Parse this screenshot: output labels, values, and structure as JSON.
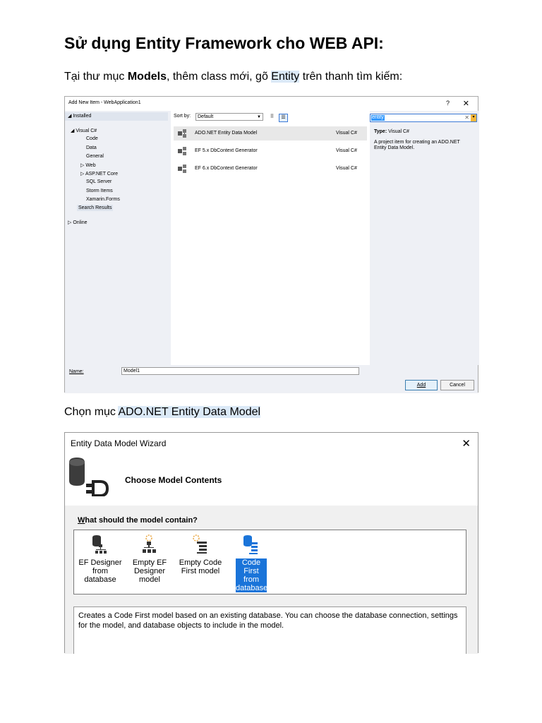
{
  "doc": {
    "title": "Sử dụng Entity Framework cho WEB API:",
    "para1": {
      "t1": "Tại thư mục ",
      "b1": "Models",
      "t2": ", thêm class mới, gõ ",
      "h1": "Entity",
      "t3": " trên thanh tìm kiếm:"
    },
    "para2": {
      "t1": "Chọn mục ",
      "h1": "ADO.NET Entity Data Model"
    }
  },
  "add_item_dialog": {
    "title": "Add New Item - WebApplication1",
    "help": "?",
    "close": "✕",
    "installed_label": "◢ Installed",
    "tree": [
      {
        "label": "◢  Visual C#"
      },
      {
        "label": "Code"
      },
      {
        "label": "Data"
      },
      {
        "label": "General"
      },
      {
        "label": "▷  Web"
      },
      {
        "label": "▷  ASP.NET Core"
      },
      {
        "label": "SQL Server"
      },
      {
        "label": "Storm Items"
      },
      {
        "label": "Xamarin.Forms"
      },
      {
        "label": "Search Results"
      },
      {
        "label": "▷  Online"
      }
    ],
    "sort_label": "Sort by:",
    "sort_value": "Default",
    "items": [
      {
        "name": "ADO.NET Entity Data Model",
        "lang": "Visual C#"
      },
      {
        "name": "EF 5.x DbContext Generator",
        "lang": "Visual C#"
      },
      {
        "name": "EF 6.x DbContext Generator",
        "lang": "Visual C#"
      }
    ],
    "search_value": "entity",
    "type_label": "Type:",
    "type_value": "Visual C#",
    "description": "A project item for creating an ADO.NET Entity Data Model.",
    "name_label": "Name:",
    "name_value": "Model1",
    "add_button": "Add",
    "cancel_button": "Cancel"
  },
  "wizard": {
    "title": "Entity Data Model Wizard",
    "close": "✕",
    "heading": "Choose Model Contents",
    "question_first": "W",
    "question_rest": "hat should the model contain?",
    "choices": [
      {
        "label": "EF Designer from database",
        "selected": false
      },
      {
        "label": "Empty EF Designer model",
        "selected": false
      },
      {
        "label": "Empty Code First model",
        "selected": false
      },
      {
        "label": "Code First from database",
        "selected": true
      }
    ],
    "description": "Creates a Code First model based on an existing database. You can choose the database connection, settings for the model, and database objects to include in the model."
  }
}
